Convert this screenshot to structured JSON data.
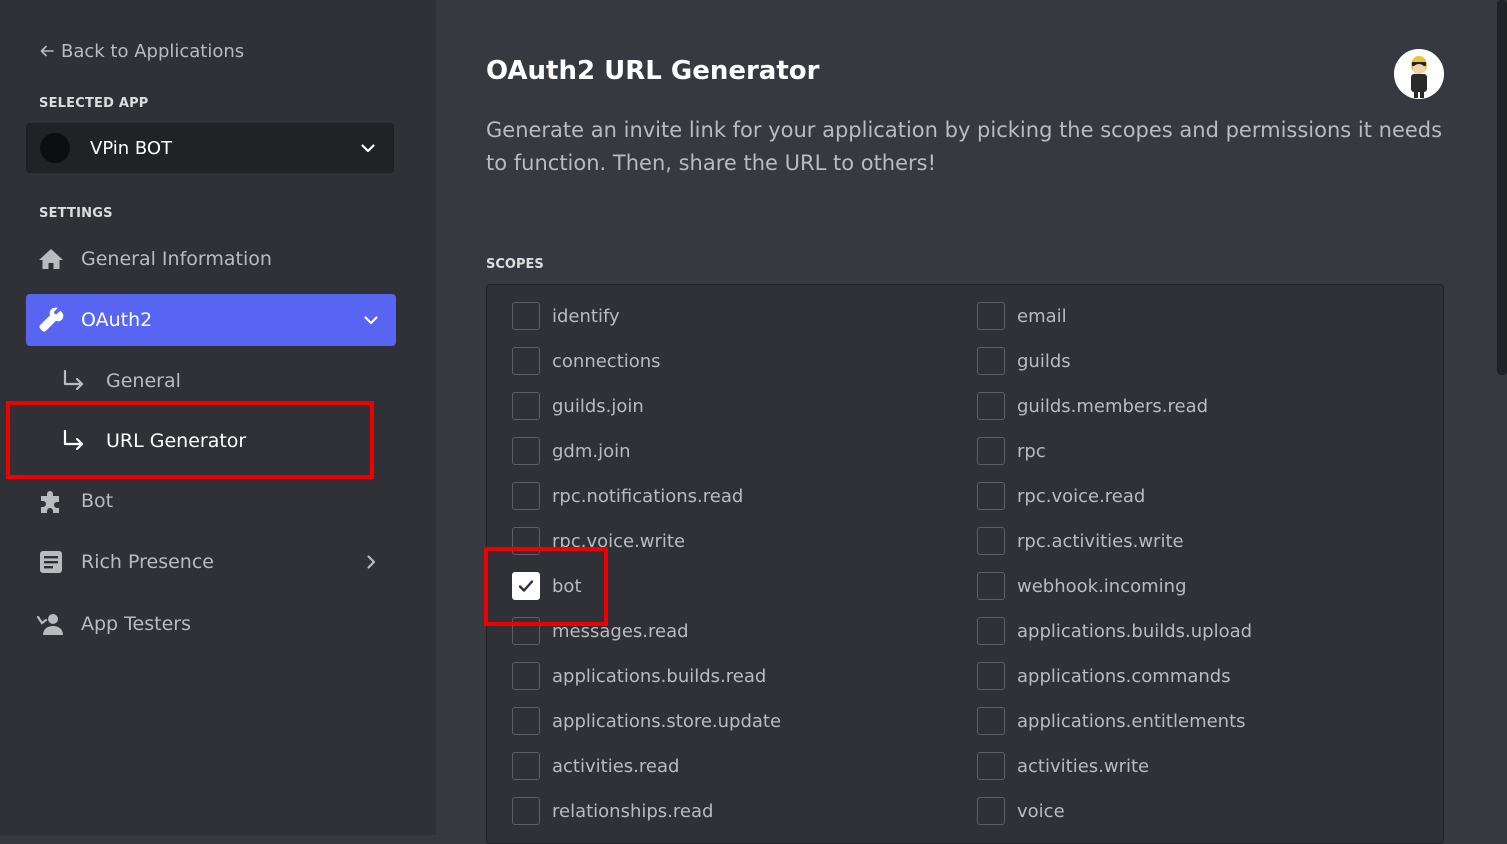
{
  "sidebar": {
    "back_label": "Back to Applications",
    "selected_app_heading": "SELECTED APP",
    "selected_app_name": "VPin BOT",
    "settings_heading": "SETTINGS",
    "items": [
      {
        "label": "General Information",
        "icon": "home-icon"
      },
      {
        "label": "OAuth2",
        "icon": "wrench-icon",
        "active": true
      },
      {
        "label": "Bot",
        "icon": "puzzle-icon"
      },
      {
        "label": "Rich Presence",
        "icon": "document-icon"
      },
      {
        "label": "App Testers",
        "icon": "person-icon"
      }
    ],
    "oauth_subitems": [
      {
        "label": "General",
        "icon": "sub-arrow-icon"
      },
      {
        "label": "URL Generator",
        "icon": "sub-arrow-icon",
        "selected": true
      }
    ]
  },
  "main": {
    "title": "OAuth2 URL Generator",
    "description": "Generate an invite link for your application by picking the scopes and permissions it needs to function. Then, share the URL to others!",
    "scopes_heading": "SCOPES",
    "scopes_left": [
      {
        "label": "identify",
        "checked": false
      },
      {
        "label": "connections",
        "checked": false
      },
      {
        "label": "guilds.join",
        "checked": false
      },
      {
        "label": "gdm.join",
        "checked": false
      },
      {
        "label": "rpc.notifications.read",
        "checked": false
      },
      {
        "label": "rpc.voice.write",
        "checked": false
      },
      {
        "label": "bot",
        "checked": true
      },
      {
        "label": "messages.read",
        "checked": false
      },
      {
        "label": "applications.builds.read",
        "checked": false
      },
      {
        "label": "applications.store.update",
        "checked": false
      },
      {
        "label": "activities.read",
        "checked": false
      },
      {
        "label": "relationships.read",
        "checked": false
      }
    ],
    "scopes_right": [
      {
        "label": "email",
        "checked": false
      },
      {
        "label": "guilds",
        "checked": false
      },
      {
        "label": "guilds.members.read",
        "checked": false
      },
      {
        "label": "rpc",
        "checked": false
      },
      {
        "label": "rpc.voice.read",
        "checked": false
      },
      {
        "label": "rpc.activities.write",
        "checked": false
      },
      {
        "label": "webhook.incoming",
        "checked": false
      },
      {
        "label": "applications.builds.upload",
        "checked": false
      },
      {
        "label": "applications.commands",
        "checked": false
      },
      {
        "label": "applications.entitlements",
        "checked": false
      },
      {
        "label": "activities.write",
        "checked": false
      },
      {
        "label": "voice",
        "checked": false
      }
    ]
  },
  "colors": {
    "accent": "#5865f2",
    "highlight": "#ee0000",
    "sidebar_bg": "#2f3136",
    "main_bg": "#36393f"
  }
}
